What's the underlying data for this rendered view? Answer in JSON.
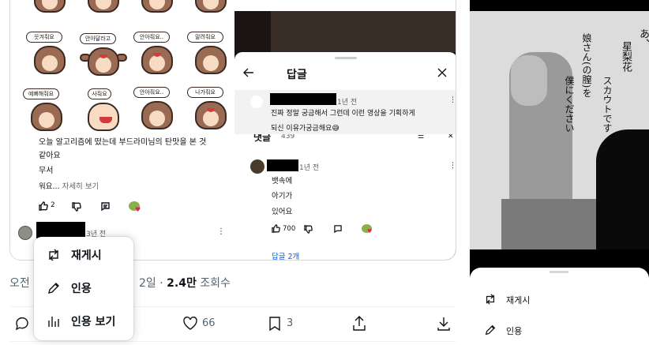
{
  "sticker_labels": [
    "웃겨줘요",
    "안아달라고",
    "안아줘요..",
    "말려줘요",
    "예뻐해줘요",
    "사줘요",
    "안아줘요..",
    "나가줘요"
  ],
  "left_comment": {
    "line1": "오늘 알고리즘에 떴는데 부드라미님의 탄맛을 본 것",
    "line2": "같아요",
    "line3": "무서",
    "line4": "워요...",
    "more": "자세히 보기",
    "likes": "2",
    "time": "3년 전"
  },
  "reply_sheet": {
    "title": "답글",
    "original_time": "1년 전",
    "original_line1": "진짜 정말 궁금해서 그런데 이런 영상을 기획하게",
    "original_line2": "되신 이유가궁금해요😅",
    "section_label": "댓글",
    "section_count": "439",
    "reply_time": "1년 전",
    "reply_lines": [
      "뱃속에",
      "아기가",
      "있어요"
    ],
    "reply_likes": "700",
    "replies_link": "답글 2개"
  },
  "meta": {
    "time_prefix": "오전",
    "date_suffix": "2일 ·",
    "views_count": "2.4만",
    "views_label": "조회수"
  },
  "actions": {
    "likes": "66",
    "bookmarks": "3"
  },
  "repost_menu": {
    "repost": "재게시",
    "quote": "인용",
    "view_quotes": "인용 보기"
  },
  "comic": {
    "text_col1": "あ、",
    "text_col2": "星梨花",
    "text_col3": "スカウトです",
    "text_col4": "娘さん(の膣)を",
    "text_col5": "僕にください"
  },
  "right_sheet": {
    "repost": "재게시",
    "quote": "인용"
  }
}
